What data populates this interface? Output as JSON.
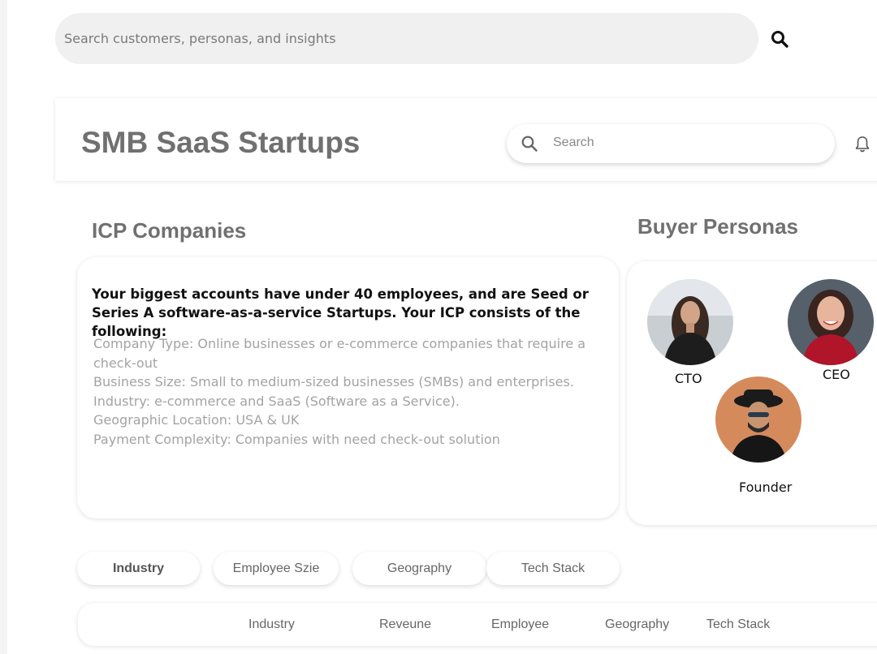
{
  "global_search": {
    "placeholder": "Search customers, personas, and insights",
    "icon": "search-icon"
  },
  "header": {
    "title": "SMB SaaS Startups",
    "search_placeholder": "Search",
    "bell_icon": "bell-icon"
  },
  "icp": {
    "title": "ICP Companies",
    "summary": "Your biggest accounts have under 40 employees, and are Seed or Series A software-as-a-service Startups. Your ICP consists of the following:",
    "details": [
      "Company Type: Online businesses or e-commerce companies that require a check-out",
      "Business Size: Small to medium-sized businesses (SMBs) and enterprises.",
      "Industry: e-commerce and SaaS (Software as a Service).",
      "Geographic Location: USA & UK",
      "Payment Complexity: Companies with need check-out solution"
    ]
  },
  "buyer_personas": {
    "title": "Buyer Personas",
    "personas": [
      {
        "label": "CTO"
      },
      {
        "label": "CEO"
      },
      {
        "label": "Founder"
      }
    ]
  },
  "filter_tabs": [
    {
      "label": "Industry",
      "active": true
    },
    {
      "label": "Employee Szie",
      "active": false
    },
    {
      "label": "Geography",
      "active": false
    },
    {
      "label": "Tech Stack",
      "active": false
    }
  ],
  "table": {
    "columns": [
      "Industry",
      "Reveune",
      "Employee",
      "Geography",
      "Tech Stack"
    ]
  },
  "colors": {
    "title_gray": "#707070",
    "search_bg": "#f0f0f0",
    "detail_text": "#a3a3a3"
  }
}
